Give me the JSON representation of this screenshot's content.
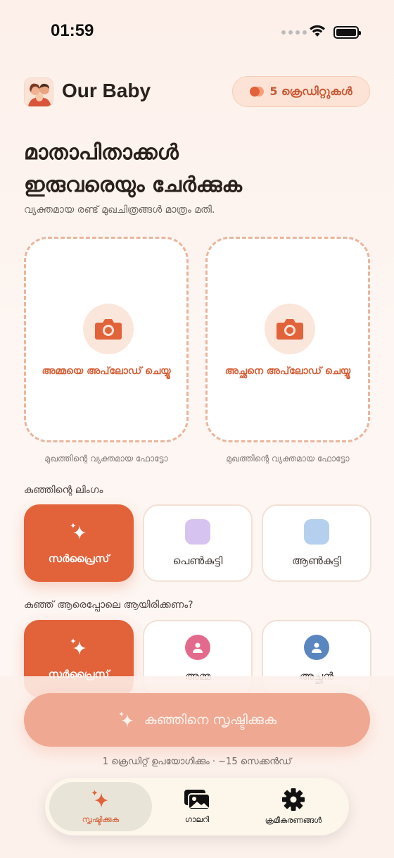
{
  "status_bar": {
    "time": "01:59"
  },
  "header": {
    "app_title": "Our Baby",
    "credits_label": "5 ക്രെഡിറ്റുകൾ"
  },
  "intro": {
    "title_line1": "മാതാപിതാക്കൾ",
    "title_line2": "ഇരുവരെയും ചേർക്കുക",
    "subtitle": "വ്യക്തമായ രണ്ട് മുഖചിത്രങ്ങൾ മാത്രം മതി."
  },
  "uploads": {
    "mother_label": "അമ്മയെ അപ്‌ലോഡ് ചെയ്യൂ",
    "father_label": "അച്ഛനെ അപ്‌ലോഡ് ചെയ്യൂ",
    "mother_note": "മുഖത്തിന്റെ വ്യക്തമായ ഫോട്ടോ",
    "father_note": "മുഖത്തിന്റെ വ്യക്തമായ ഫോട്ടോ"
  },
  "gender": {
    "label": "കുഞ്ഞിന്റെ ലിംഗം",
    "options": [
      {
        "label": "സർപ്രൈസ്",
        "selected": true
      },
      {
        "label": "പെൺകുട്ടി",
        "selected": false,
        "color": "#d7c3ef"
      },
      {
        "label": "ആൺകുട്ടി",
        "selected": false,
        "color": "#b4d0ee"
      }
    ]
  },
  "resemblance": {
    "label": "കുഞ്ഞ് ആരെപ്പോലെ ആയിരിക്കണം?",
    "options": [
      {
        "label": "സർപ്രൈസ്",
        "selected": true
      },
      {
        "label": "അമ്മ",
        "selected": false,
        "color": "#e36a8c"
      },
      {
        "label": "അച്ഛൻ",
        "selected": false,
        "color": "#5a86bf"
      }
    ]
  },
  "cta": {
    "label": "കുഞ്ഞിനെ സൃഷ്ടിക്കുക",
    "note": "1 ക്രെഡിറ്റ് ഉപയോഗിക്കും · ~15 സെക്കൻഡ്"
  },
  "tabs": {
    "create": "സൃഷ്ടിക്കുക",
    "gallery": "ഗാലറി",
    "settings": "ക്രമീകരണങ്ങൾ"
  },
  "colors": {
    "accent": "#e2623a",
    "cta_disabled": "#efa891"
  }
}
